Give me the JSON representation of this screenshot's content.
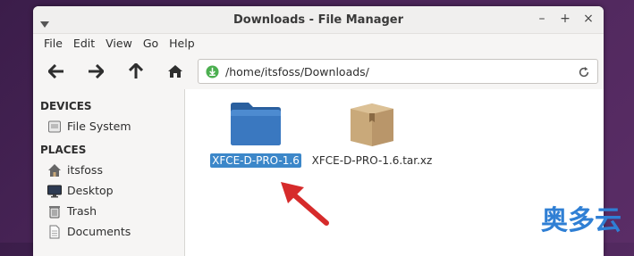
{
  "window": {
    "title": "Downloads - File Manager",
    "controls": [
      "–",
      "+",
      "×"
    ]
  },
  "menubar": [
    "File",
    "Edit",
    "View",
    "Go",
    "Help"
  ],
  "toolbar": {
    "location": "/home/itsfoss/Downloads/"
  },
  "sidebar": {
    "devices_header": "DEVICES",
    "devices": [
      {
        "label": "File System",
        "icon": "drive-icon"
      }
    ],
    "places_header": "PLACES",
    "places": [
      {
        "label": "itsfoss",
        "icon": "home-icon"
      },
      {
        "label": "Desktop",
        "icon": "desktop-icon"
      },
      {
        "label": "Trash",
        "icon": "trash-icon"
      },
      {
        "label": "Documents",
        "icon": "document-icon"
      }
    ]
  },
  "files": [
    {
      "name": "XFCE-D-PRO-1.6",
      "type": "folder",
      "selected": true
    },
    {
      "name": "XFCE-D-PRO-1.6.tar.xz",
      "type": "archive",
      "selected": false
    }
  ],
  "watermark": "奥多云",
  "colors": {
    "selection": "#3c87c9",
    "folder": "#3a78c0",
    "archive": "#c9a97a",
    "arrow": "#d62b2b",
    "watermark": "#2f7fd4"
  }
}
